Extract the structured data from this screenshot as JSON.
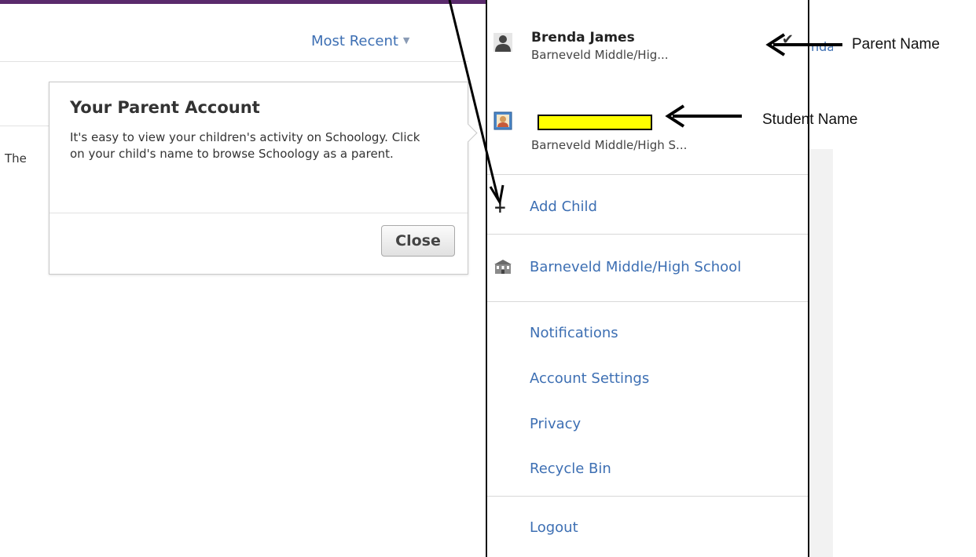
{
  "feed": {
    "sort_label": "Most Recent",
    "partial_text": "The"
  },
  "popover": {
    "title": "Your Parent Account",
    "body": "It's easy to view your children's activity on Schoology. Click on your child's name to browse Schoology as a parent.",
    "close_label": "Close"
  },
  "menu": {
    "parent": {
      "name": "Brenda James",
      "school": "Barneveld Middle/Hig..."
    },
    "child": {
      "school": "Barneveld Middle/High S..."
    },
    "add_child_label": "Add Child",
    "school_link": "Barneveld Middle/High School",
    "items": [
      {
        "label": "Notifications"
      },
      {
        "label": "Account Settings"
      },
      {
        "label": "Privacy"
      },
      {
        "label": "Recycle Bin"
      }
    ],
    "logout_label": "Logout",
    "behind_text": "nda"
  },
  "annotations": {
    "parent_label": "Parent Name",
    "student_label": "Student Name"
  },
  "colors": {
    "link": "#3d6fb3",
    "topbar": "#5a2a6c",
    "redaction": "#ffff00"
  },
  "icons": {
    "parent": "person-silhouette-icon",
    "child": "student-avatar-icon",
    "check": "checkmark-icon",
    "add": "plus-icon",
    "school": "school-building-icon",
    "sort": "caret-down-icon"
  }
}
